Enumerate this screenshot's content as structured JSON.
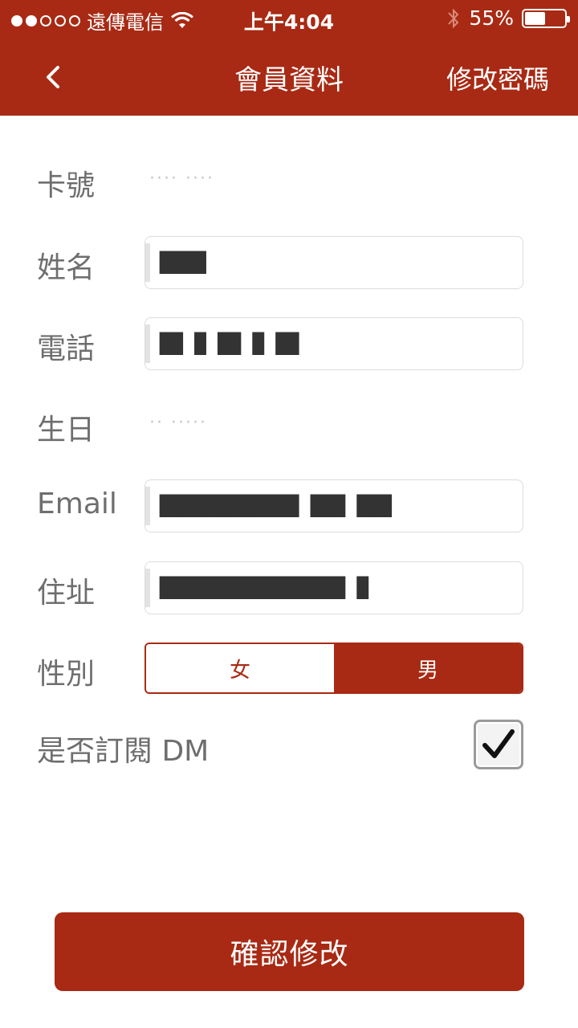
{
  "colors": {
    "brand": "#a82a14"
  },
  "status_bar": {
    "carrier": "遠傳電信",
    "signal_dots": 5,
    "signal_active": 2,
    "time": "上午4:04",
    "battery_percent_text": "55%",
    "battery_level": 0.55
  },
  "nav": {
    "back_icon": "chevron-left-icon",
    "title": "會員資料",
    "action_label": "修改密碼"
  },
  "form": {
    "card_label": "卡號",
    "card_value": "···· ····",
    "name_label": "姓名",
    "name_value": "████",
    "phone_label": "電話",
    "phone_value": "██ █ ██ █ ██",
    "birthday_label": "生日",
    "birthday_value": "·· ·····",
    "email_label": "Email",
    "email_value": "████████████ ███ ███",
    "address_label": "住址",
    "address_value": "████████████████ █",
    "gender_label": "性別",
    "gender_options": [
      "女",
      "男"
    ],
    "gender_selected": "男",
    "dm_label": "是否訂閱 DM",
    "dm_checked": true
  },
  "submit_label": "確認修改"
}
